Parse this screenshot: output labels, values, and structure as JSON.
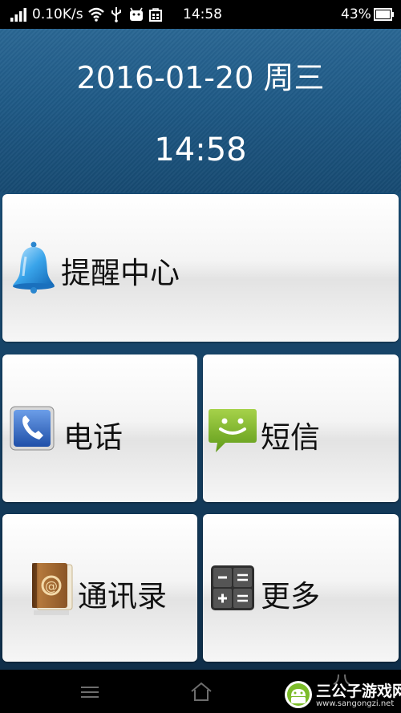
{
  "status_bar": {
    "speed": "0.10K/s",
    "time": "14:58",
    "battery": "43%",
    "icons": [
      "signal-icon",
      "wifi-icon",
      "usb-icon",
      "android-icon",
      "store-icon",
      "battery-icon"
    ]
  },
  "header": {
    "date": "2016-01-20 周三",
    "time": "14:58"
  },
  "tiles": [
    {
      "label": "提醒中心",
      "icon": "bell-icon"
    },
    {
      "label": "电话",
      "icon": "phone-icon"
    },
    {
      "label": "短信",
      "icon": "sms-icon"
    },
    {
      "label": "通讯录",
      "icon": "contacts-book-icon"
    },
    {
      "label": "更多",
      "icon": "calculator-icon"
    }
  ],
  "nav_bar": {
    "icons": [
      "menu-icon",
      "home-icon",
      "back-icon"
    ]
  },
  "watermark": {
    "name": "三公子游戏网",
    "url": "www.sangongzi.net"
  },
  "colors": {
    "header_bg": "#1f5a86",
    "tile_bg": "#f4f4f4",
    "bars": "#000000"
  }
}
